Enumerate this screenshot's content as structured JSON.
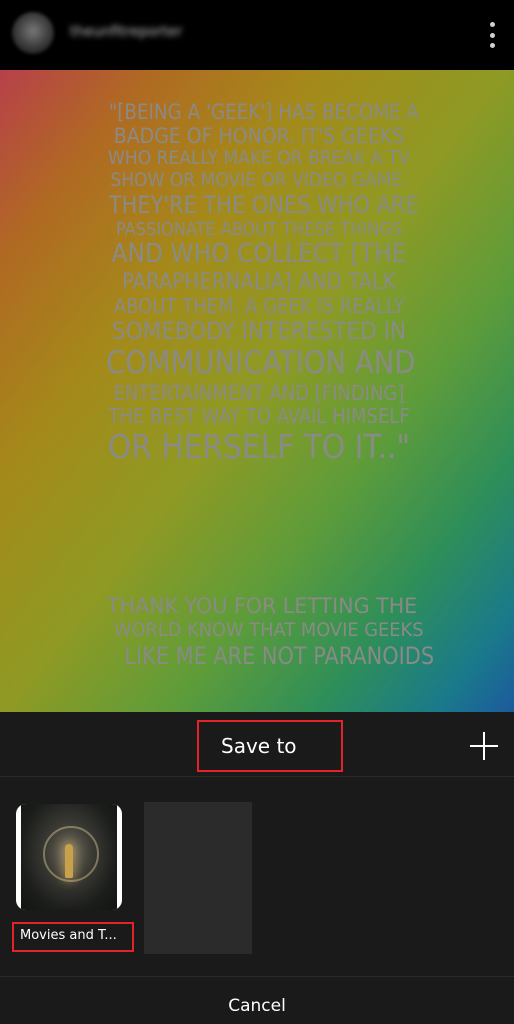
{
  "header": {
    "username": "theunfitreporter",
    "more_icon": "more-vertical-icon"
  },
  "story": {
    "quote_lines": [
      "\"[Being a 'geek'] has become a",
      "badge of honor. It's geeks",
      "who really make or break a TV",
      "show or movie or video game.",
      "They're the ones who are",
      "passionate about these things",
      "and who collect [the",
      "paraphernalia] and talk",
      "about them. A geek is really",
      "somebody interested in",
      "communication and",
      "entertainment and [finding]",
      "the best way to avail himself",
      "or herself to it..\""
    ],
    "thanks_lines": [
      "Thank you for letting the",
      "world know that  movie geeks",
      "like me are not paranoids"
    ],
    "gradient_colors": [
      "#b8404a",
      "#a48a1a",
      "#5e9c3a",
      "#1c5a9e"
    ]
  },
  "sheet": {
    "title": "Save to",
    "add_icon": "plus-icon",
    "collection_label": "Movies and T...",
    "cancel_label": "Cancel",
    "highlight_color": "#e3222a"
  }
}
